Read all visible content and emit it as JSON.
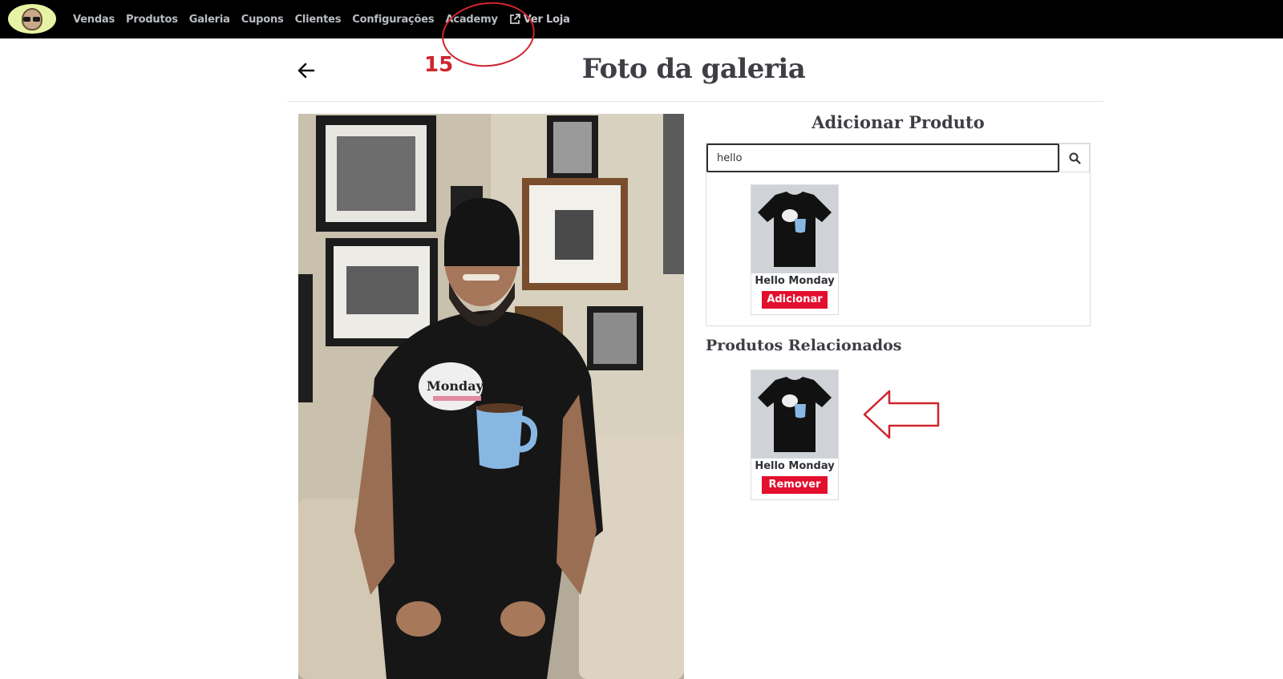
{
  "nav": {
    "items": [
      "Vendas",
      "Produtos",
      "Galeria",
      "Cupons",
      "Clientes",
      "Configurações",
      "Academy"
    ],
    "store_link": "Ver Loja"
  },
  "annotation": {
    "step_number": "15",
    "color": "#d0242e"
  },
  "page": {
    "title": "Foto da galeria"
  },
  "add_product": {
    "title": "Adicionar Produto",
    "search_value": "hello",
    "results": [
      {
        "name": "Hello Monday",
        "action_label": "Adicionar"
      }
    ]
  },
  "related": {
    "title": "Produtos Relacionados",
    "items": [
      {
        "name": "Hello Monday",
        "action_label": "Remover"
      }
    ]
  },
  "colors": {
    "accent_button": "#e30f2e",
    "topbar": "#000000"
  }
}
